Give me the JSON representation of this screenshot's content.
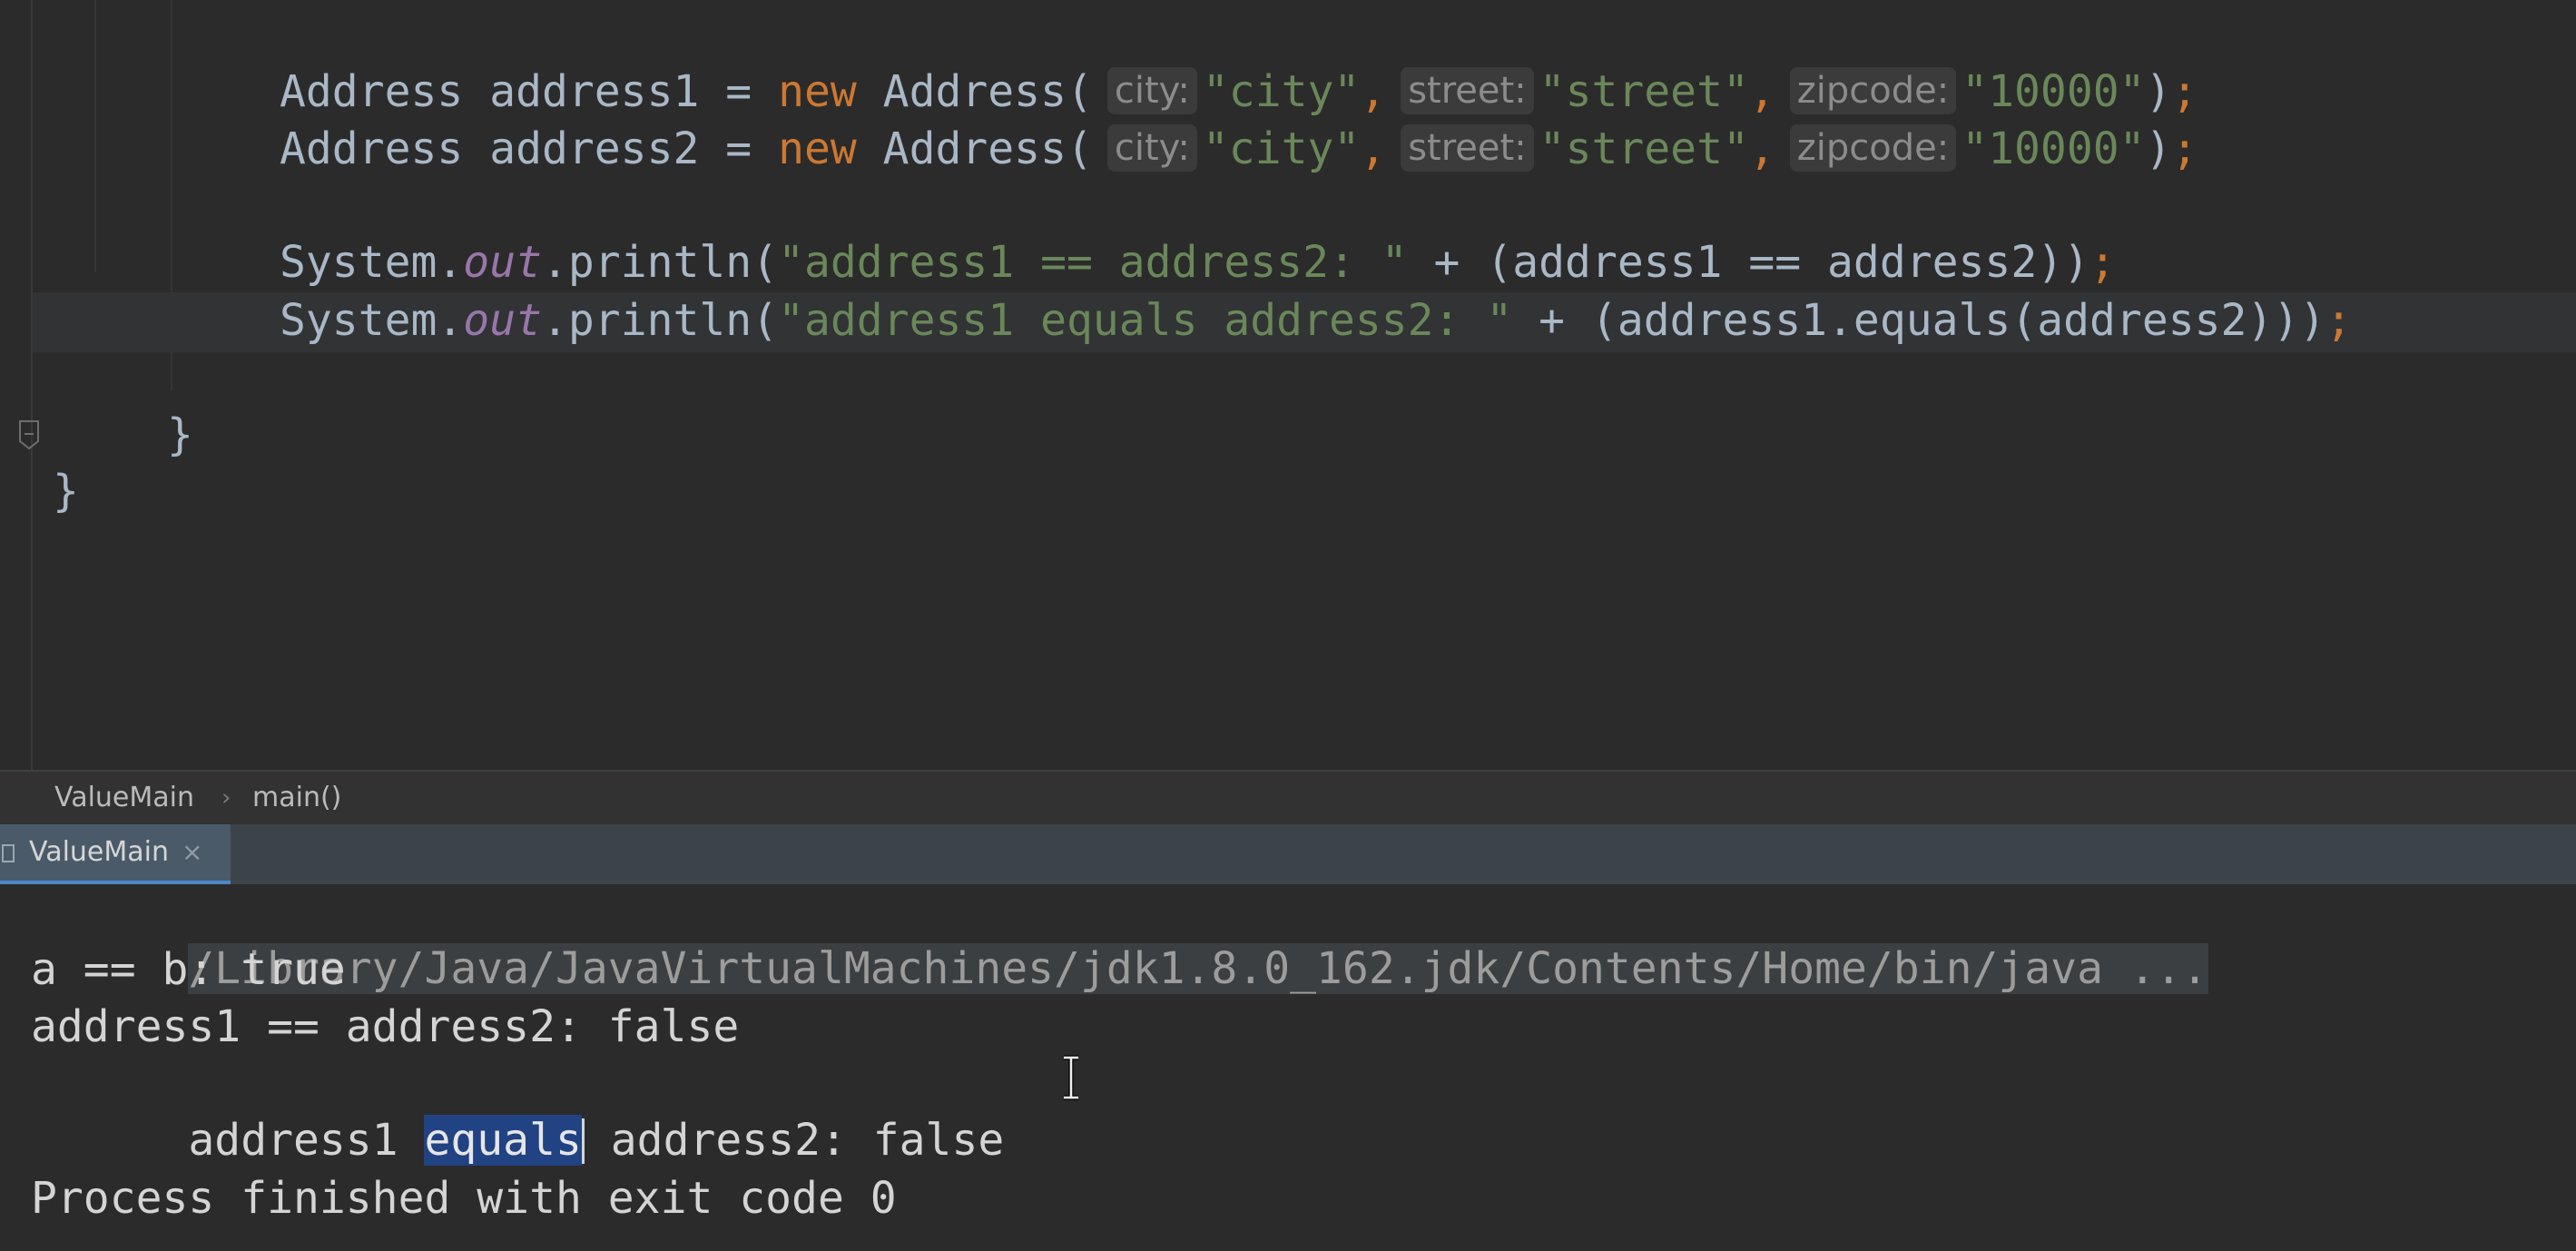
{
  "editor": {
    "lines": [
      {
        "id": "decl1",
        "tokens": [
          {
            "t": "Address address1 = ",
            "c": "plain"
          },
          {
            "t": "new",
            "c": "kw"
          },
          {
            "t": " Address(",
            "c": "plain"
          },
          {
            "t": "city:",
            "c": "hint"
          },
          {
            "t": "\"city\"",
            "c": "str"
          },
          {
            "t": ",",
            "c": "punct"
          },
          {
            "t": "street:",
            "c": "hint"
          },
          {
            "t": "\"street\"",
            "c": "str"
          },
          {
            "t": ",",
            "c": "punct"
          },
          {
            "t": "zipcode:",
            "c": "hint"
          },
          {
            "t": "\"10000\"",
            "c": "str"
          },
          {
            "t": ")",
            "c": "plain"
          },
          {
            "t": ";",
            "c": "punct"
          }
        ]
      },
      {
        "id": "decl2",
        "tokens": [
          {
            "t": "Address address2 = ",
            "c": "plain"
          },
          {
            "t": "new",
            "c": "kw"
          },
          {
            "t": " Address(",
            "c": "plain"
          },
          {
            "t": "city:",
            "c": "hint"
          },
          {
            "t": "\"city\"",
            "c": "str"
          },
          {
            "t": ",",
            "c": "punct"
          },
          {
            "t": "street:",
            "c": "hint"
          },
          {
            "t": "\"street\"",
            "c": "str"
          },
          {
            "t": ",",
            "c": "punct"
          },
          {
            "t": "zipcode:",
            "c": "hint"
          },
          {
            "t": "\"10000\"",
            "c": "str"
          },
          {
            "t": ")",
            "c": "plain"
          },
          {
            "t": ";",
            "c": "punct"
          }
        ]
      },
      {
        "id": "print1",
        "tokens": [
          {
            "t": "System.",
            "c": "plain"
          },
          {
            "t": "out",
            "c": "field"
          },
          {
            "t": ".println(",
            "c": "plain"
          },
          {
            "t": "\"address1 == address2: \"",
            "c": "str"
          },
          {
            "t": " + (address1 == address2))",
            "c": "plain"
          },
          {
            "t": ";",
            "c": "punct"
          }
        ]
      },
      {
        "id": "print2",
        "tokens": [
          {
            "t": "System.",
            "c": "plain"
          },
          {
            "t": "out",
            "c": "field"
          },
          {
            "t": ".println(",
            "c": "plain"
          },
          {
            "t": "\"address1 equals address2: \"",
            "c": "str"
          },
          {
            "t": " + (address1.equals(address2)))",
            "c": "plain"
          },
          {
            "t": ";",
            "c": "punct"
          }
        ]
      },
      {
        "id": "close-method",
        "tokens": [
          {
            "t": "}",
            "c": "plain"
          }
        ]
      },
      {
        "id": "close-class",
        "tokens": [
          {
            "t": "}",
            "c": "plain"
          }
        ]
      }
    ]
  },
  "breadcrumb": {
    "items": [
      "ValueMain",
      "main()"
    ],
    "separator": "›"
  },
  "run_panel": {
    "tab_label": "ValueMain",
    "close_glyph": "×"
  },
  "console": {
    "command": "/Library/Java/JavaVirtualMachines/jdk1.8.0_162.jdk/Contents/Home/bin/java ...",
    "line_ab": "a == b: true",
    "line_eq_op": "address1 == address2: false",
    "line_equals_before": "address1 ",
    "line_equals_selected": "equals",
    "line_equals_after": " address2: false",
    "exit_message": "Process finished with exit code 0"
  },
  "colors": {
    "background": "#2b2b2b",
    "keyword": "#cc7832",
    "string": "#6a8759",
    "field": "#9876aa",
    "selection": "#214283",
    "tab_underline": "#4a88c7"
  }
}
